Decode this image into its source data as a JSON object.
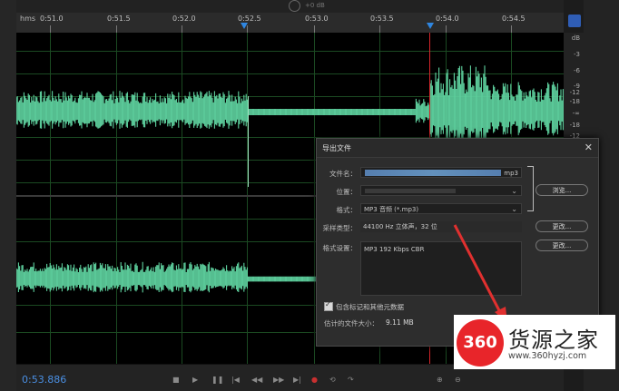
{
  "top_bar": {
    "db_value": "+0 dB"
  },
  "ruler": {
    "unit": "hms",
    "ticks": [
      "0:51.0",
      "0:51.5",
      "0:52.0",
      "0:52.5",
      "0:53.0",
      "0:53.5",
      "0:54.0",
      "0:54.5"
    ]
  },
  "db_scale": {
    "unit": "dB",
    "labels": [
      "-3",
      "-6",
      "-9",
      "-12",
      "-18",
      "-∞",
      "-18",
      "-12"
    ]
  },
  "transport": {
    "time": "0:53.886"
  },
  "dialog": {
    "title": "导出文件",
    "close": "✕",
    "filename_label": "文件名：",
    "filename_suffix": "mp3",
    "location_label": "位置：",
    "format_label": "格式：",
    "format_value": "MP3 音频 (*.mp3)",
    "browse_button": "浏览...",
    "sample_type_label": "采样类型：",
    "sample_type_value": "44100 Hz 立体声，32 位",
    "change_button_1": "更改...",
    "format_settings_label": "格式设置：",
    "format_settings_value": "MP3 192 Kbps CBR",
    "change_button_2": "更改...",
    "include_markers_label": "包含标记和其他元数据",
    "estimated_size_label": "估计的文件大小：",
    "estimated_size_value": "9.11 MB"
  },
  "watermark": {
    "logo": "360",
    "brand": "货源之家",
    "url": "www.360hyzj.com"
  },
  "colors": {
    "waveform": "#5fd3a0",
    "grid": "#1b4a22",
    "playhead": "#d8262b",
    "accent_blue": "#2f86e0",
    "watermark_red": "#e8252a"
  }
}
